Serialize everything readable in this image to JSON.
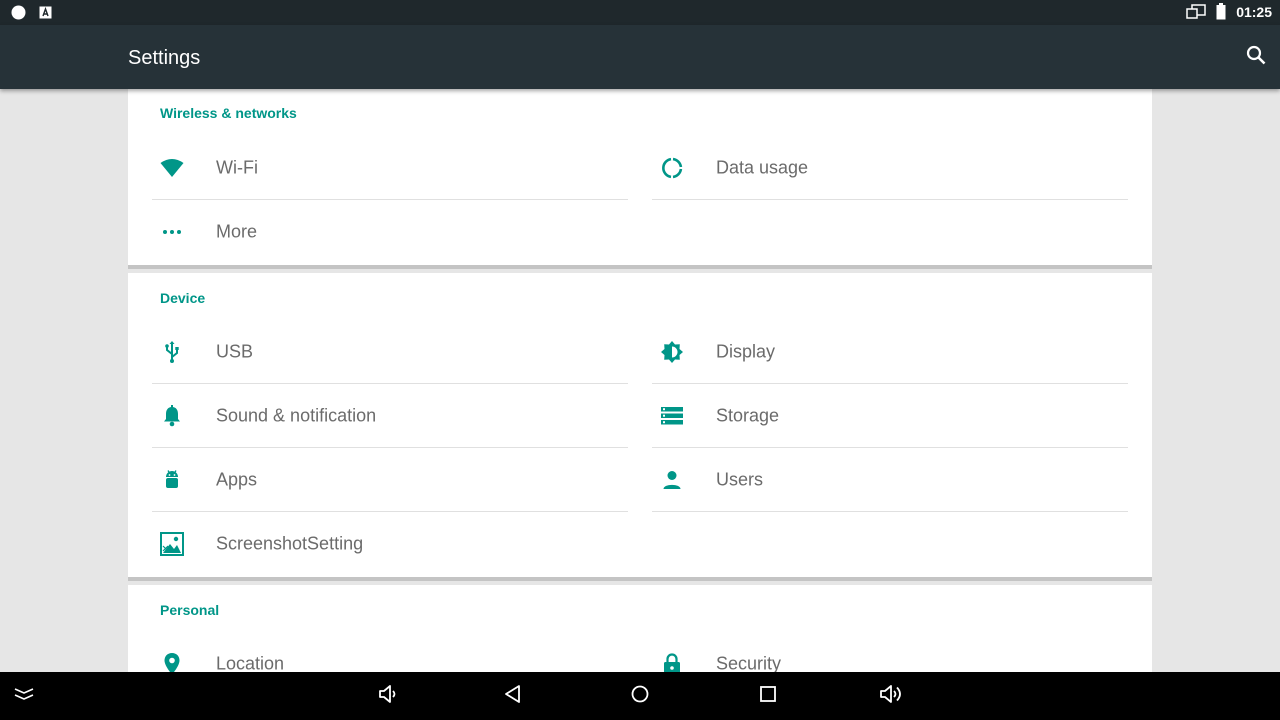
{
  "status_bar": {
    "time": "01:25",
    "icons_left": [
      "circle-notification-icon",
      "a-notification-icon"
    ],
    "icons_right": [
      "screen-cast-icon",
      "battery-icon"
    ]
  },
  "app_bar": {
    "title": "Settings",
    "search_icon": "search-icon"
  },
  "sections": {
    "wireless": {
      "title": "Wireless & networks",
      "items": [
        {
          "label": "Wi-Fi",
          "icon": "wifi-icon"
        },
        {
          "label": "Data usage",
          "icon": "data-usage-icon"
        },
        {
          "label": "More",
          "icon": "more-dots-icon"
        }
      ]
    },
    "device": {
      "title": "Device",
      "items": [
        {
          "label": "USB",
          "icon": "usb-icon"
        },
        {
          "label": "Display",
          "icon": "brightness-icon"
        },
        {
          "label": "Sound & notification",
          "icon": "bell-icon"
        },
        {
          "label": "Storage",
          "icon": "storage-icon"
        },
        {
          "label": "Apps",
          "icon": "android-icon"
        },
        {
          "label": "Users",
          "icon": "user-icon"
        },
        {
          "label": "ScreenshotSetting",
          "icon": "screenshot-icon"
        }
      ]
    },
    "personal": {
      "title": "Personal",
      "items": [
        {
          "label": "Location",
          "icon": "location-icon"
        },
        {
          "label": "Security",
          "icon": "lock-icon"
        }
      ]
    }
  },
  "nav_bar": {
    "buttons": [
      "collapse-icon",
      "volume-down-icon",
      "back-icon",
      "home-icon",
      "recents-icon",
      "volume-up-icon"
    ]
  },
  "colors": {
    "accent": "#009688",
    "app_bar": "#263238",
    "status_bar": "#1f282c",
    "background": "#e6e6e6",
    "label": "#6b6b6b"
  }
}
